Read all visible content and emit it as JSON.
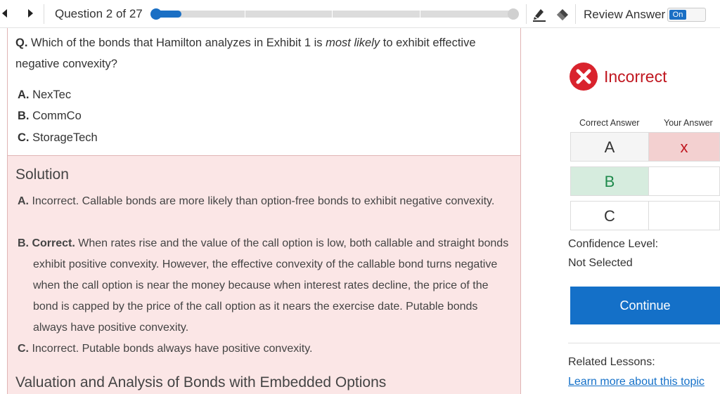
{
  "topbar": {
    "question_counter": "Question 2 of 27",
    "progress_fraction": 0.07,
    "review_label": "Review Answer",
    "toggle_state": "On",
    "tools": [
      "highlighter-icon",
      "eraser-icon"
    ]
  },
  "question": {
    "prefix": "Q.",
    "text_before": " Which of the bonds that Hamilton analyzes in Exhibit 1 is ",
    "text_emphasis": "most likely",
    "text_after": " to exhibit effective negative convexity?",
    "choices": [
      {
        "letter": "A.",
        "text": "NexTec"
      },
      {
        "letter": "B.",
        "text": "CommCo"
      },
      {
        "letter": "C.",
        "text": "StorageTech"
      }
    ]
  },
  "solution": {
    "title": "Solution",
    "items": [
      {
        "letter": "A.",
        "status": "Incorrect.",
        "text": "Callable bonds are more likely than option-free bonds to exhibit negative convexity."
      },
      {
        "letter": "B.",
        "status": "Correct.",
        "text": "When rates rise and the value of the call option is low, both callable and straight bonds exhibit positive convexity. However, the effective convexity of the callable bond turns negative when the call option is near the money because when interest rates decline, the price of the bond is capped by the price of the call option as it nears the exercise date. Putable bonds always have positive convexity."
      },
      {
        "letter": "C.",
        "status": "Incorrect.",
        "text": "Putable bonds always have positive convexity."
      }
    ],
    "footer": "Valuation and Analysis of Bonds with Embedded Options"
  },
  "result": {
    "label": "Incorrect",
    "color": "#c0161f"
  },
  "answers": {
    "correct_header": "Correct Answer",
    "yours_header": "Your Answer",
    "rows": [
      {
        "letter": "A",
        "mark": "x"
      },
      {
        "letter": "B",
        "mark": ""
      },
      {
        "letter": "C",
        "mark": ""
      }
    ]
  },
  "confidence": {
    "label": "Confidence Level:",
    "value": "Not Selected"
  },
  "continue_label": "Continue",
  "related": {
    "label": "Related Lessons:",
    "link": "Learn more about this topic"
  }
}
